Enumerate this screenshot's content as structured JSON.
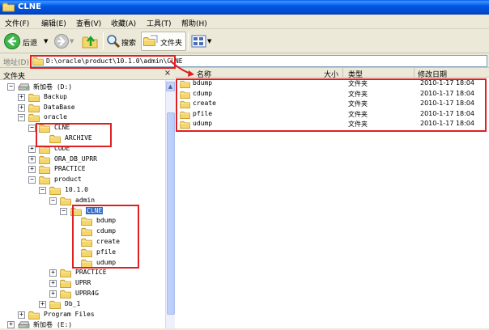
{
  "window": {
    "title": "CLNE"
  },
  "menubar": {
    "items": [
      "文件(F)",
      "编辑(E)",
      "查看(V)",
      "收藏(A)",
      "工具(T)",
      "帮助(H)"
    ]
  },
  "toolbar": {
    "back_label": "后退",
    "search_label": "搜索",
    "folders_label": "文件夹"
  },
  "address": {
    "label": "地址(D)",
    "path": "D:\\oracle\\product\\10.1.0\\admin\\CLNE"
  },
  "folders_pane": {
    "title": "文件夹",
    "tree": [
      {
        "label": "新加卷 (D:)",
        "expander": "−",
        "type": "drive"
      },
      {
        "label": "Backup",
        "expander": "+",
        "type": "folder"
      },
      {
        "label": "DataBase",
        "expander": "+",
        "type": "folder"
      },
      {
        "label": "oracle",
        "expander": "−",
        "type": "folder"
      },
      {
        "label": "CLNE",
        "expander": "−",
        "type": "folder"
      },
      {
        "label": "ARCHIVE",
        "expander": "",
        "type": "folder"
      },
      {
        "label": "CODE",
        "expander": "+",
        "type": "folder"
      },
      {
        "label": "ORA_DB_UPRR",
        "expander": "+",
        "type": "folder"
      },
      {
        "label": "PRACTICE",
        "expander": "+",
        "type": "folder"
      },
      {
        "label": "product",
        "expander": "−",
        "type": "folder"
      },
      {
        "label": "10.1.0",
        "expander": "−",
        "type": "folder"
      },
      {
        "label": "admin",
        "expander": "−",
        "type": "folder"
      },
      {
        "label": "CLNE",
        "expander": "−",
        "type": "folder",
        "selected": true
      },
      {
        "label": "bdump",
        "expander": "",
        "type": "folder"
      },
      {
        "label": "cdump",
        "expander": "",
        "type": "folder"
      },
      {
        "label": "create",
        "expander": "",
        "type": "folder"
      },
      {
        "label": "pfile",
        "expander": "",
        "type": "folder"
      },
      {
        "label": "udump",
        "expander": "",
        "type": "folder"
      },
      {
        "label": "PRACTICE",
        "expander": "+",
        "type": "folder"
      },
      {
        "label": "UPRR",
        "expander": "+",
        "type": "folder"
      },
      {
        "label": "UPRR4G",
        "expander": "+",
        "type": "folder"
      },
      {
        "label": "Db_1",
        "expander": "+",
        "type": "folder"
      },
      {
        "label": "Program Files",
        "expander": "+",
        "type": "folder"
      },
      {
        "label": "新加卷 (E:)",
        "expander": "+",
        "type": "drive"
      }
    ]
  },
  "content": {
    "columns": {
      "name": "名称",
      "size": "大小",
      "type": "类型",
      "modified": "修改日期"
    },
    "files": [
      {
        "name": "bdump",
        "size": "",
        "type": "文件夹",
        "modified": "2010-1-17 18:04"
      },
      {
        "name": "cdump",
        "size": "",
        "type": "文件夹",
        "modified": "2010-1-17 18:04"
      },
      {
        "name": "create",
        "size": "",
        "type": "文件夹",
        "modified": "2010-1-17 18:04"
      },
      {
        "name": "pfile",
        "size": "",
        "type": "文件夹",
        "modified": "2010-1-17 18:04"
      },
      {
        "name": "udump",
        "size": "",
        "type": "文件夹",
        "modified": "2010-1-17 18:04"
      }
    ]
  },
  "colors": {
    "annotation_red": "#e02020",
    "selection": "#316ac5",
    "folder_yellow": "#f5d66b"
  },
  "icons": [
    "folder-icon",
    "drive-icon",
    "back-arrow-icon",
    "forward-arrow-icon",
    "up-folder-icon",
    "search-icon",
    "folders-icon",
    "views-icon"
  ]
}
